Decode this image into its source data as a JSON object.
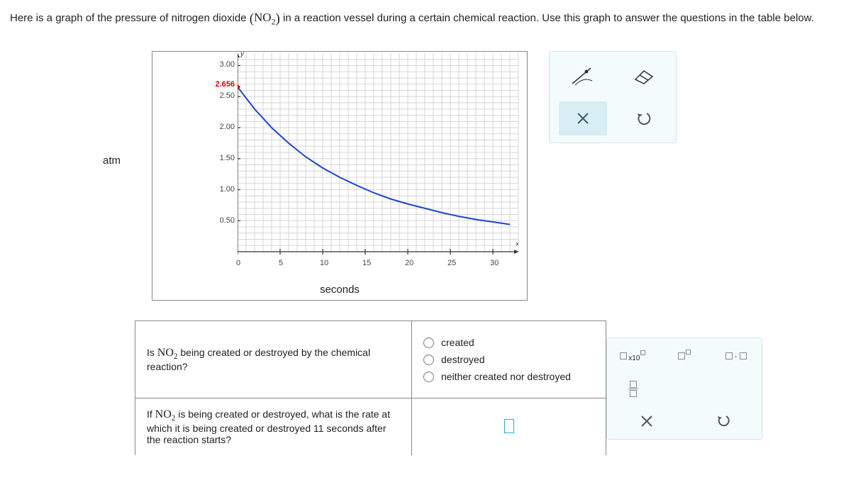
{
  "intro": {
    "before": "Here is a graph of the pressure of nitrogen dioxide ",
    "chem_base": "NO",
    "chem_sub": "2",
    "after": " in a reaction vessel during a certain chemical reaction. Use this graph to answer the questions in the table below."
  },
  "graph": {
    "y_label": "atm",
    "x_label": "seconds",
    "y_var": "y",
    "x_var": "x",
    "y_ticks": [
      "0.50",
      "1.00",
      "1.50",
      "2.00",
      "2.50",
      "3.00"
    ],
    "x_ticks": [
      "0",
      "5",
      "10",
      "15",
      "20",
      "25",
      "30"
    ],
    "y_marker": "2.656"
  },
  "q1": {
    "text_a": "Is ",
    "chem_base": "NO",
    "chem_sub": "2",
    "text_b": " being created or destroyed by the chemical reaction?",
    "opt1": "created",
    "opt2": "destroyed",
    "opt3": "neither created nor destroyed"
  },
  "q2": {
    "text_a": "If ",
    "chem_base": "NO",
    "chem_sub": "2",
    "text_b": " is being created or destroyed, what is the rate at which it is being created or destroyed 11 seconds after the reaction starts?"
  },
  "symtools": {
    "x10": "x10"
  },
  "chart_data": {
    "type": "line",
    "title": "",
    "xlabel": "seconds",
    "ylabel": "atm",
    "xlim": [
      0,
      33
    ],
    "ylim": [
      0,
      3.2
    ],
    "x_ticks": [
      0,
      5,
      10,
      15,
      20,
      25,
      30
    ],
    "y_ticks": [
      0.5,
      1.0,
      1.5,
      2.0,
      2.5,
      3.0
    ],
    "series": [
      {
        "name": "NO2 pressure",
        "x": [
          0,
          2,
          4,
          6,
          8,
          10,
          12,
          14,
          16,
          18,
          20,
          22,
          24,
          26,
          28,
          30,
          32
        ],
        "values": [
          2.656,
          2.3,
          2.0,
          1.75,
          1.53,
          1.35,
          1.2,
          1.07,
          0.95,
          0.85,
          0.77,
          0.7,
          0.63,
          0.57,
          0.52,
          0.48,
          0.44
        ]
      }
    ],
    "annotations": [
      {
        "x": 0,
        "y": 2.656,
        "label": "2.656",
        "color": "#d40000"
      }
    ]
  }
}
